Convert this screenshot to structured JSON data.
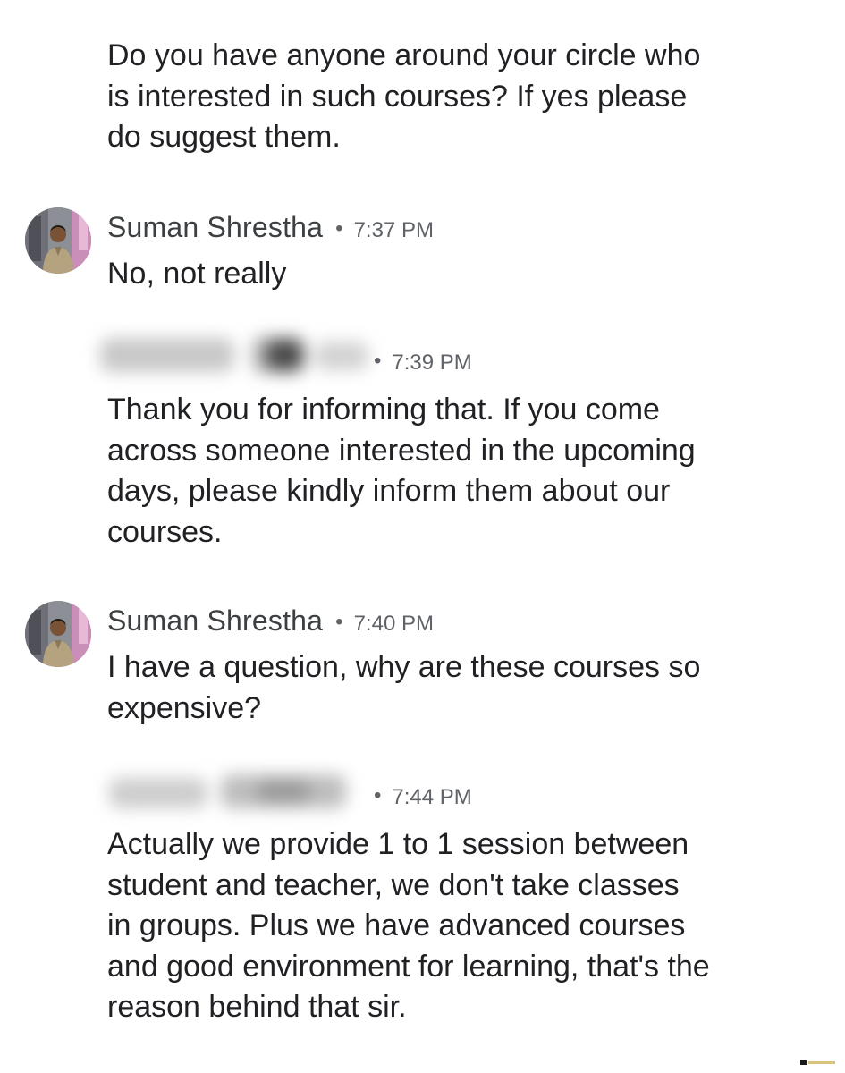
{
  "messages": [
    {
      "text": "Do you have anyone around your circle who\nis interested in such courses? If yes please\ndo suggest them."
    },
    {
      "sender": "Suman Shrestha",
      "time": "7:37 PM",
      "text": "No, not really",
      "avatar_icon": "user-photo-avatar"
    },
    {
      "sender": "",
      "time": "7:39 PM",
      "text": "Thank you for informing that. If you come\nacross someone interested in the upcoming\ndays, please kindly inform them about our\ncourses."
    },
    {
      "sender": "Suman Shrestha",
      "time": "7:40 PM",
      "text": "I have a question, why are these courses so\nexpensive?",
      "avatar_icon": "user-photo-avatar"
    },
    {
      "sender": "",
      "time": "7:44 PM",
      "text": "Actually we provide 1 to 1 session between\nstudent and teacher, we don't take classes\nin groups. Plus we have advanced courses\nand good environment for learning, that's the\nreason behind that sir."
    }
  ],
  "separator": "•",
  "colors": {
    "text": "#202124",
    "sender": "#3c4043",
    "timestamp": "#5f6368",
    "background": "#ffffff"
  }
}
